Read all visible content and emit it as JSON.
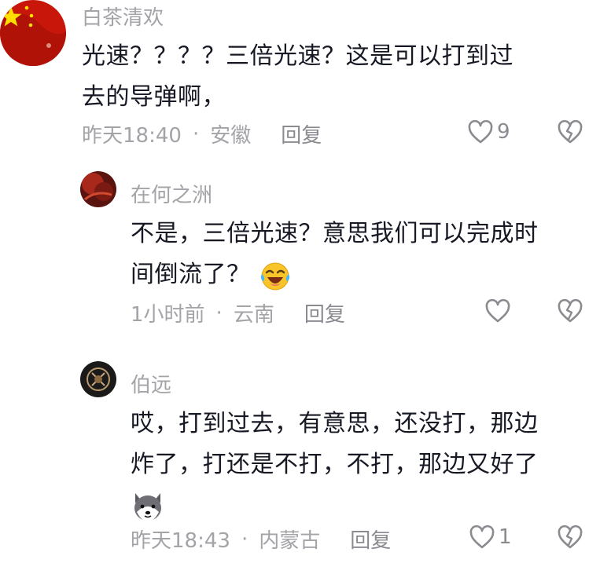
{
  "comments": [
    {
      "username": "白茶清欢",
      "lines": [
        "光速？？？？三倍光速？这是可以打到过",
        "去的导弹啊，"
      ],
      "time": "昨天18:40",
      "location": "安徽",
      "reply": "回复",
      "likes": "9",
      "avatar_icon": "china-flag-avatar"
    },
    {
      "username": "在何之洲",
      "lines": [
        "不是，三倍光速？意思我们可以完成时",
        "间倒流了？"
      ],
      "emoji": "laughing-crying-emoji",
      "time": "1小时前",
      "location": "云南",
      "reply": "回复",
      "likes": "",
      "avatar_icon": "red-dark-avatar"
    },
    {
      "username": "伯远",
      "lines": [
        "哎，打到过去，有意思，还没打，那边",
        "炸了，打还是不打，不打，那边又好了"
      ],
      "emoji": "husky-dog-emoji",
      "time": "昨天18:43",
      "location": "内蒙古",
      "reply": "回复",
      "likes": "1",
      "avatar_icon": "dark-emblem-avatar"
    }
  ],
  "separator": "·",
  "colors": {
    "meta": "#a3a3a8",
    "text": "#161823",
    "flag_red": "#d81e06",
    "flag_star": "#ffde00"
  }
}
